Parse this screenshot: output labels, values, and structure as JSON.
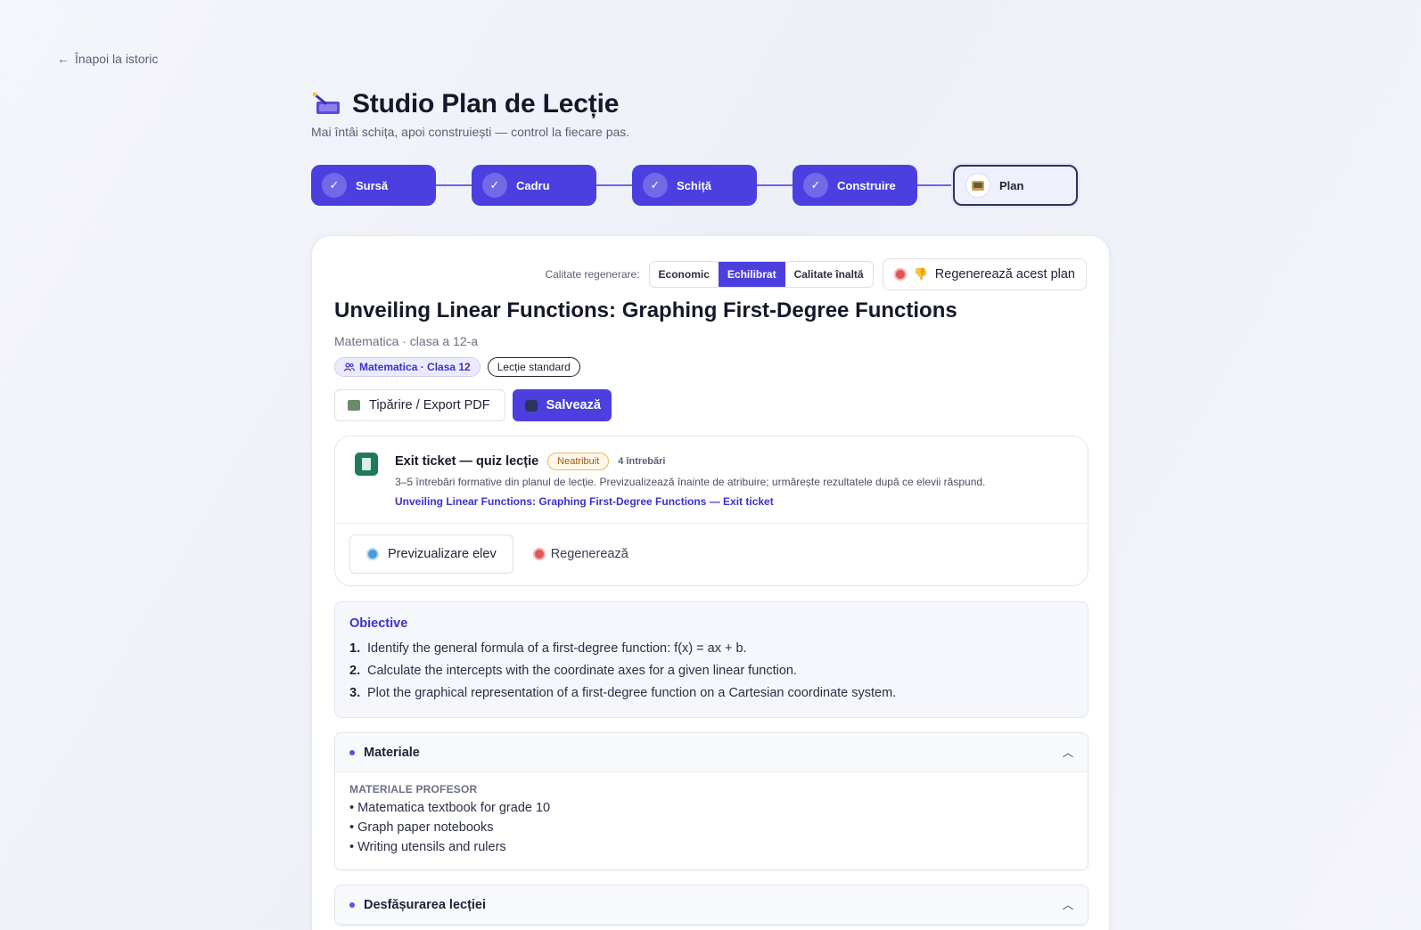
{
  "nav": {
    "back_label": "Înapoi la istoric"
  },
  "header": {
    "title": "Studio Plan de Lecție",
    "subtitle": "Mai întâi schița, apoi construiești — control la fiecare pas."
  },
  "steps": [
    {
      "label": "Sursă",
      "state": "done"
    },
    {
      "label": "Cadru",
      "state": "done"
    },
    {
      "label": "Schiță",
      "state": "done"
    },
    {
      "label": "Construire",
      "state": "done"
    },
    {
      "label": "Plan",
      "state": "current"
    }
  ],
  "regen": {
    "label": "Calitate regenerare:",
    "options": [
      "Economic",
      "Echilibrat",
      "Calitate înaltă"
    ],
    "selected": "Echilibrat",
    "button": "Regenerează acest plan"
  },
  "lesson": {
    "title": "Unveiling Linear Functions: Graphing First-Degree Functions",
    "meta": "Matematica · clasa a 12-a",
    "badge_subject": "Matematica · Clasa 12",
    "badge_type": "Lecție standard",
    "print_button": "Tipărire / Export PDF",
    "save_button": "Salvează"
  },
  "exit_ticket": {
    "title": "Exit ticket — quiz lecție",
    "status": "Neatribuit",
    "count": "4 întrebări",
    "description": "3–5 întrebări formative din planul de lecție. Previzualizează înainte de atribuire; urmărește rezultatele după ce elevii răspund.",
    "link": "Unveiling Linear Functions: Graphing First-Degree Functions — Exit ticket",
    "preview_button": "Previzualizare elev",
    "regen_button": "Regenerează"
  },
  "objectives": {
    "title": "Obiective",
    "items": [
      "Identify the general formula of a first-degree function: f(x) = ax + b.",
      "Calculate the intercepts with the coordinate axes for a given linear function.",
      "Plot the graphical representation of a first-degree function on a Cartesian coordinate system."
    ]
  },
  "materials": {
    "title": "Materiale",
    "label": "MATERIALE PROFESOR",
    "items": [
      "• Matematica textbook for grade 10",
      "• Graph paper notebooks",
      "• Writing utensils and rulers"
    ]
  },
  "lesson_flow": {
    "title": "Desfășurarea lecției"
  },
  "icons": {
    "check": "check-icon",
    "plan": "book-icon",
    "regen": "refresh-icon",
    "thumb": "thumbs-down-icon",
    "accent": "#4b3fe0"
  }
}
